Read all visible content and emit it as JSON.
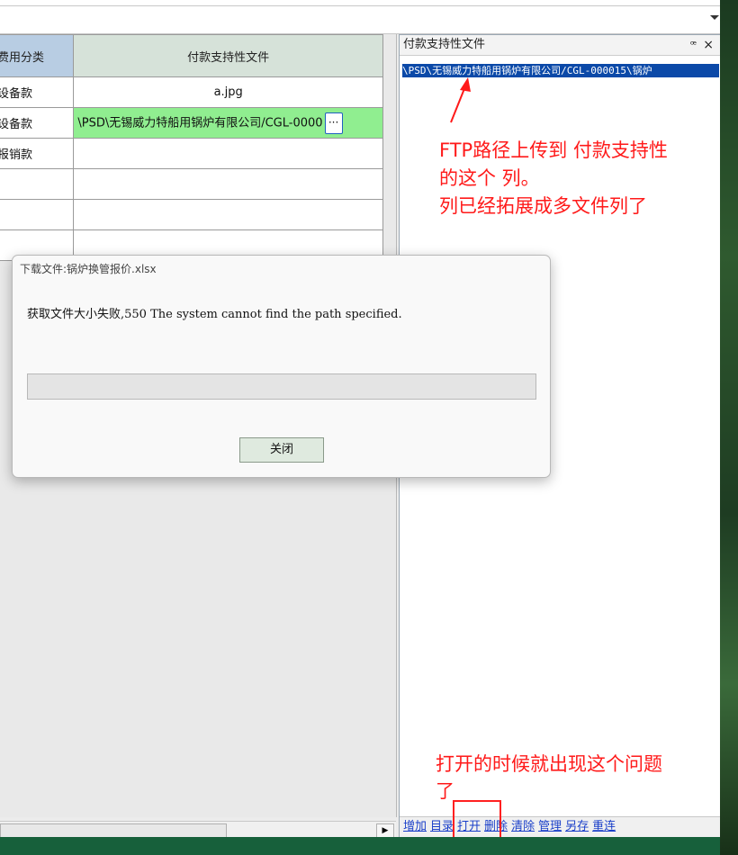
{
  "grid": {
    "headers": [
      "费用分类",
      "付款支持性文件"
    ],
    "rows": [
      {
        "category": "设备款",
        "file": "a.jpg"
      },
      {
        "category": "设备款",
        "file": "\\PSD\\无锡威力特船用锅炉有限公司/CGL-0000"
      },
      {
        "category": "报销款",
        "file": ""
      },
      {
        "category": "",
        "file": ""
      },
      {
        "category": "",
        "file": ""
      },
      {
        "category": "",
        "file": ""
      }
    ],
    "ellipsis": "···"
  },
  "panel": {
    "title": "付款支持性文件",
    "pin": "ꟹ",
    "close": "×",
    "path": "\\PSD\\无锡威力特船用锅炉有限公司/CGL-000015\\锅炉",
    "toolbar": [
      "增加",
      "目录",
      "打开",
      "删除",
      "清除",
      "管理",
      "另存",
      "重连"
    ]
  },
  "annotations": {
    "top_lines": [
      "FTP路径上传到 付款支持性",
      "的这个 列。",
      "列已经拓展成多文件列了"
    ],
    "bottom_lines": [
      "打开的时候就出现这个问题",
      "了"
    ]
  },
  "dialog": {
    "title": "下载文件:锅炉换管报价.xlsx",
    "message": "获取文件大小失败,550 The system cannot find the path specified.",
    "button": "关闭",
    "progress": 0
  },
  "colors": {
    "accent_highlight": "#0b49a8",
    "annotation": "#ff1a1a",
    "green_cell": "#90ee90"
  }
}
